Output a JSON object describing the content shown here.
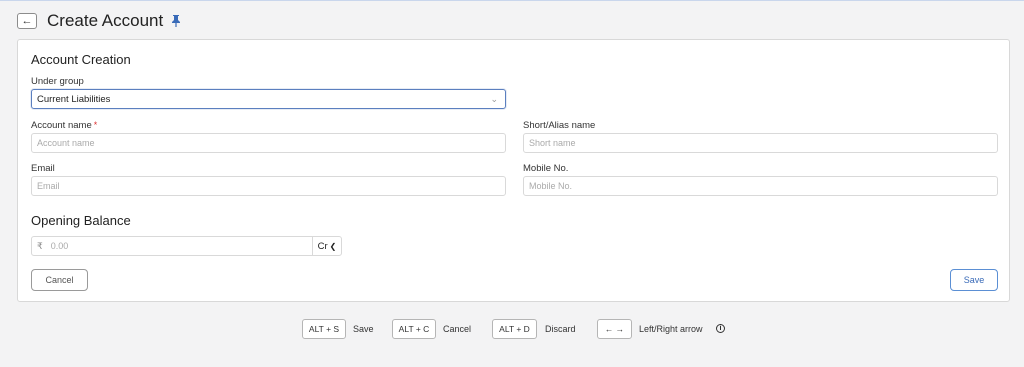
{
  "header": {
    "back_icon": "←",
    "title": "Create Account",
    "pin_icon": "pin-icon"
  },
  "account_creation": {
    "title": "Account Creation",
    "under_group": {
      "label": "Under group",
      "value": "Current Liabilities"
    },
    "account_name": {
      "label": "Account name",
      "required_mark": "*",
      "placeholder": "Account name"
    },
    "short_name": {
      "label": "Short/Alias name",
      "placeholder": "Short name"
    },
    "email": {
      "label": "Email",
      "placeholder": "Email"
    },
    "mobile": {
      "label": "Mobile No.",
      "placeholder": "Mobile No."
    }
  },
  "opening_balance": {
    "title": "Opening Balance",
    "currency_symbol": "₹",
    "placeholder": "0.00",
    "type_value": "Cr"
  },
  "actions": {
    "cancel_label": "Cancel",
    "save_label": "Save"
  },
  "shortcuts": [
    {
      "key": "ALT + S",
      "label": "Save"
    },
    {
      "key": "ALT + C",
      "label": "Cancel"
    },
    {
      "key": "ALT + D",
      "label": "Discard"
    },
    {
      "key": "← →",
      "label": "Left/Right arrow"
    }
  ],
  "info_icon": "i",
  "colors": {
    "accent": "#5b8fd4",
    "pin": "#3a6bb8",
    "required": "#dd3333"
  }
}
